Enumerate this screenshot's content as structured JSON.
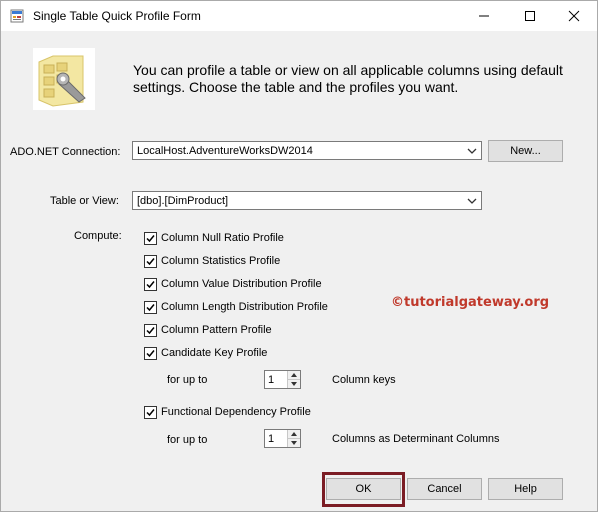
{
  "window": {
    "title": "Single Table Quick Profile Form",
    "icon": "form-app-icon"
  },
  "header": {
    "description": "You can profile a table or view on all applicable columns using default settings. Choose the table and the profiles you want.",
    "icon": "wrench-table-icon"
  },
  "connection": {
    "label": "ADO.NET Connection:",
    "value": "LocalHost.AdventureWorksDW2014",
    "new_button": "New..."
  },
  "table": {
    "label": "Table or View:",
    "value": "[dbo].[DimProduct]"
  },
  "compute": {
    "label": "Compute:",
    "profiles": [
      {
        "label": "Column Null Ratio Profile",
        "checked": true
      },
      {
        "label": "Column Statistics Profile",
        "checked": true
      },
      {
        "label": "Column Value Distribution Profile",
        "checked": true
      },
      {
        "label": "Column Length Distribution Profile",
        "checked": true
      },
      {
        "label": "Column Pattern Profile",
        "checked": true
      },
      {
        "label": "Candidate Key Profile",
        "checked": true
      }
    ],
    "candidate_key": {
      "for_up_to": "for up to",
      "value": "1",
      "unit": "Column keys"
    },
    "functional_dependency": {
      "label": "Functional Dependency Profile",
      "checked": true
    },
    "fd_options": {
      "for_up_to": "for up to",
      "value": "1",
      "unit": "Columns as Determinant Columns"
    }
  },
  "watermark": "©tutorialgateway.org",
  "buttons": {
    "ok": "OK",
    "cancel": "Cancel",
    "help": "Help"
  },
  "colors": {
    "focus_border": "#7b1c24",
    "watermark": "#c0392b"
  }
}
